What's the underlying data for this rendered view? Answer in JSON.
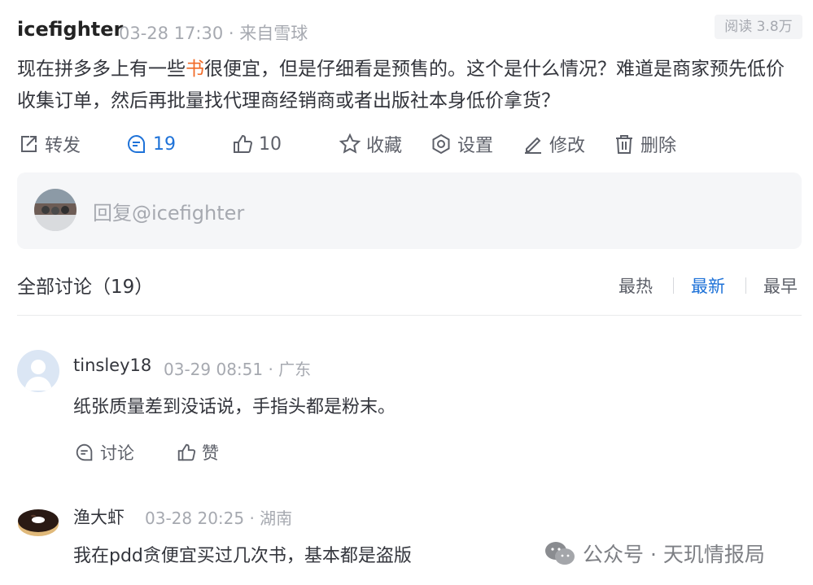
{
  "post": {
    "author": "icefighter",
    "time": "03-28 17:30",
    "source": "· 来自雪球",
    "views": "阅读 3.8万",
    "text_before": "现在拼多多上有一些",
    "text_highlight": "书",
    "text_after": "很便宜，但是仔细看是预售的。这个是什么情况？难道是商家预先低价收集订单，然后再批量找代理商经销商或者出版社本身低价拿货？"
  },
  "actions": {
    "forward": "转发",
    "comments": "19",
    "likes": "10",
    "favorite": "收藏",
    "settings": "设置",
    "edit": "修改",
    "delete": "删除"
  },
  "reply": {
    "placeholder": "回复@icefighter"
  },
  "discussion": {
    "title": "全部讨论（19）",
    "sort_hot": "最热",
    "sort_new": "最新",
    "sort_early": "最早"
  },
  "comments": [
    {
      "name": "tinsley18",
      "time": "03-29 08:51",
      "location": "· 广东",
      "text": "纸张质量差到没话说，手指头都是粉末。",
      "discuss": "讨论",
      "like": "赞"
    },
    {
      "name": "渔大虾",
      "time": "03-28 20:25",
      "location": "· 湖南",
      "text": "我在pdd贪便宜买过几次书，基本都是盗版"
    }
  ],
  "watermark": "公众号 · 天玑情报局",
  "colors": {
    "accent": "#1e72d8",
    "highlight": "#f16a27",
    "muted": "#a6a9b0"
  }
}
